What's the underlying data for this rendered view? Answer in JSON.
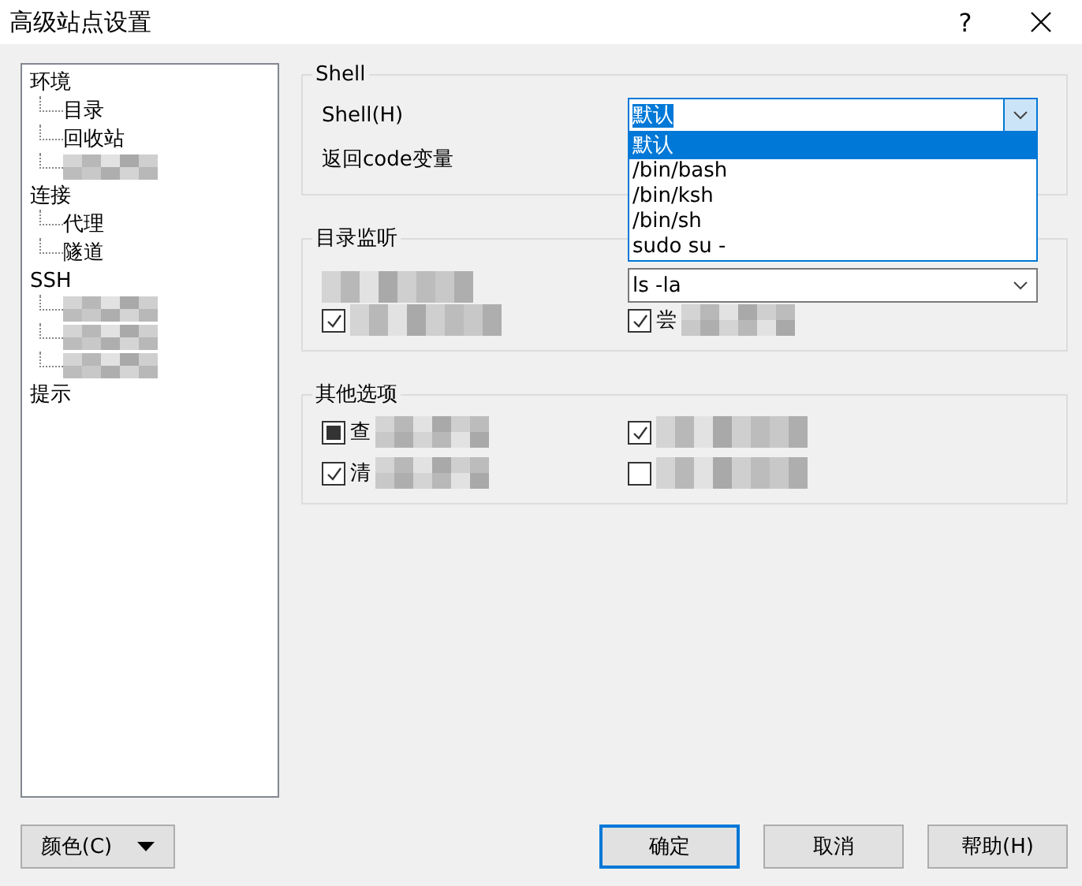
{
  "window": {
    "title": "高级站点设置",
    "help": "?"
  },
  "tree": [
    {
      "label": "环境",
      "kind": "text",
      "children": [
        {
          "label": "目录",
          "kind": "text"
        },
        {
          "label": "回收站",
          "kind": "text"
        },
        {
          "kind": "blurred"
        }
      ]
    },
    {
      "label": "连接",
      "kind": "text",
      "children": [
        {
          "label": "代理",
          "kind": "text"
        },
        {
          "label": "隧道",
          "kind": "text"
        }
      ]
    },
    {
      "label": "SSH",
      "kind": "text",
      "children": [
        {
          "kind": "blurred"
        },
        {
          "kind": "blurred"
        },
        {
          "kind": "blurred"
        }
      ]
    },
    {
      "label": "提示",
      "kind": "text"
    }
  ],
  "shell_group": {
    "title": "Shell",
    "shell_label": "Shell(H)",
    "return_code_label": "返回code变量",
    "shell_combo": {
      "value": "默认",
      "expanded": true,
      "options": [
        {
          "label": "默认",
          "selected": true
        },
        {
          "label": "/bin/bash",
          "selected": false
        },
        {
          "label": "/bin/ksh",
          "selected": false
        },
        {
          "label": "/bin/sh",
          "selected": false
        },
        {
          "label": "sudo su -",
          "selected": false
        }
      ]
    }
  },
  "dir_group": {
    "title": "目录监听",
    "command_combo": {
      "value": "ls -la"
    },
    "checkboxes": [
      {
        "kind": "blurred",
        "checked": true
      },
      {
        "kind": "partly_blurred",
        "label": "尝",
        "checked": true
      }
    ]
  },
  "other_group": {
    "title": "其他选项",
    "checkboxes": [
      {
        "kind": "partly_blurred",
        "label": "查",
        "checked": true,
        "mixed": true
      },
      {
        "kind": "blurred",
        "checked": true
      },
      {
        "kind": "partly_blurred",
        "label": "清",
        "checked": true
      },
      {
        "kind": "blurred",
        "checked": false
      }
    ]
  },
  "buttons": [
    {
      "label": "颜色(C)",
      "kind": "menu"
    },
    {
      "label": "确定",
      "kind": "default"
    },
    {
      "label": "取消",
      "kind": "normal"
    },
    {
      "label": "帮助(H)",
      "kind": "normal"
    }
  ]
}
